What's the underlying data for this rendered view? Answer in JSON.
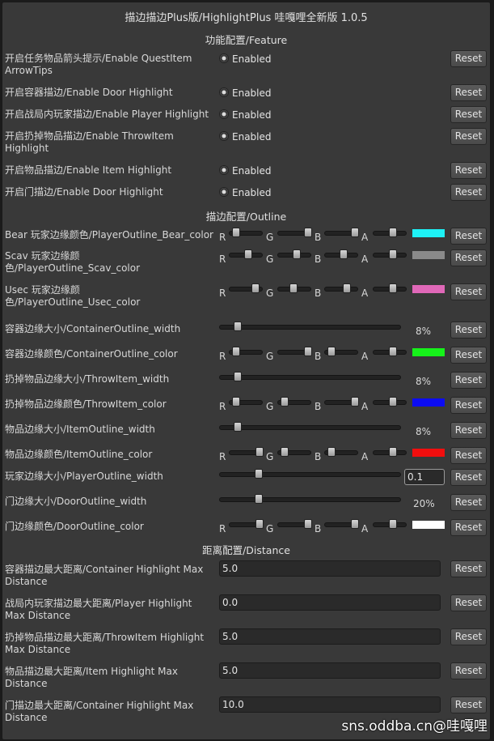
{
  "title": "描边描边Plus版/HighlightPlus 哇嘎哩全新版 1.0.5",
  "reset_label": "Reset",
  "channels": [
    "R",
    "G",
    "B",
    "A"
  ],
  "sections": {
    "feature": "功能配置/Feature",
    "outline": "描边配置/Outline",
    "distance": "距离配置/Distance"
  },
  "feature": [
    {
      "label": "开启任务物品箭头提示/Enable QuestItem ArrowTips",
      "state": "Enabled"
    },
    {
      "label": "开启容器描边/Enable Door Highlight",
      "state": "Enabled"
    },
    {
      "label": "开启战局内玩家描边/Enable Player Highlight",
      "state": "Enabled"
    },
    {
      "label": "开启扔掉物品描边/Enable ThrowItem Highlight",
      "state": "Enabled"
    },
    {
      "label": "开启物品描边/Enable Item Highlight",
      "state": "Enabled"
    },
    {
      "label": "开启门描边/Enable Door Highlight",
      "state": "Enabled"
    }
  ],
  "outline": [
    {
      "type": "color",
      "label": "Bear 玩家边缘颜色/PlayerOutline_Bear_color",
      "rgba": [
        0.1,
        1.0,
        1.0,
        0.6
      ],
      "swatch": "#1ef2f6"
    },
    {
      "type": "color",
      "label": "Scav 玩家边缘颜色/PlayerOutline_Scav_color",
      "rgba": [
        0.55,
        0.55,
        0.55,
        0.6
      ],
      "swatch": "#8a8a8a"
    },
    {
      "type": "color",
      "label": "Usec 玩家边缘颜色/PlayerOutline_Usec_color",
      "rgba": [
        0.85,
        0.45,
        0.7,
        0.6
      ],
      "swatch": "#e068b8"
    },
    {
      "type": "percent",
      "label": "容器边缘大小/ContainerOutline_width",
      "value": 0.08,
      "text": "8%"
    },
    {
      "type": "color",
      "label": "容器边缘颜色/ContainerOutline_color",
      "rgba": [
        0.1,
        1.0,
        0.1,
        0.6
      ],
      "swatch": "#16f21a"
    },
    {
      "type": "percent",
      "label": "扔掉物品边缘大小/ThrowItem_width",
      "value": 0.08,
      "text": "8%"
    },
    {
      "type": "color",
      "label": "扔掉物品边缘颜色/ThrowItem_color",
      "rgba": [
        0.1,
        0.1,
        1.0,
        0.6
      ],
      "swatch": "#0c0cf2"
    },
    {
      "type": "percent",
      "label": "物品边缘大小/ItemOutline_width",
      "value": 0.08,
      "text": "8%"
    },
    {
      "type": "color",
      "label": "物品边缘颜色/ItemOutline_color",
      "rgba": [
        1.0,
        0.1,
        0.1,
        0.6
      ],
      "swatch": "#f20e0e"
    },
    {
      "type": "number",
      "label": "玩家边缘大小/PlayerOutline_width",
      "value": 0.2,
      "text": "0.1"
    },
    {
      "type": "percent",
      "label": "门边缘大小/DoorOutline_width",
      "value": 0.2,
      "text": "20%"
    },
    {
      "type": "color",
      "label": "门边缘颜色/DoorOutline_color",
      "rgba": [
        1.0,
        1.0,
        1.0,
        0.6
      ],
      "swatch": "#ffffff"
    }
  ],
  "distance": [
    {
      "label": "容器描边最大距离/Container Highlight Max Distance",
      "value": "5.0"
    },
    {
      "label": "战局内玩家描边最大距离/Player Highlight Max Distance",
      "value": "0.0"
    },
    {
      "label": "扔掉物品描边最大距离/ThrowItem Highlight Max Distance",
      "value": "5.0"
    },
    {
      "label": "物品描边最大距离/Item Highlight Max Distance",
      "value": "5.0"
    },
    {
      "label": "门描边最大距离/Container Highlight Max Distance",
      "value": "10.0"
    }
  ],
  "watermark": "sns.oddba.cn@哇嘎哩"
}
